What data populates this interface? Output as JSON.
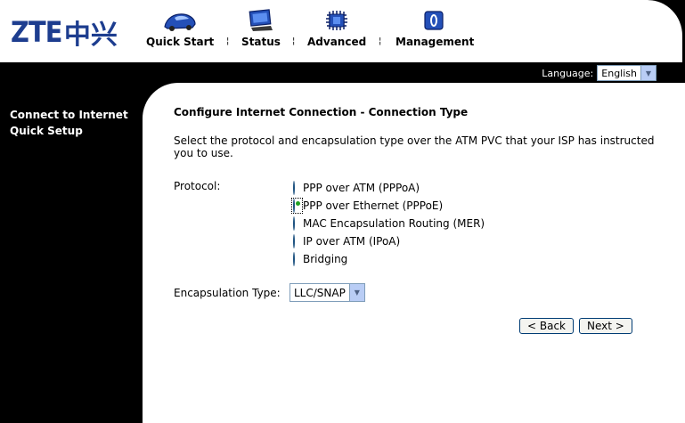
{
  "brand": {
    "name": "ZTE",
    "cn": "中兴"
  },
  "nav": [
    {
      "label": "Quick Start",
      "icon": "car-icon"
    },
    {
      "label": "Status",
      "icon": "monitor-icon"
    },
    {
      "label": "Advanced",
      "icon": "chip-icon"
    },
    {
      "label": "Management",
      "icon": "shield-icon"
    }
  ],
  "nav_separator": "¦",
  "language": {
    "label": "Language:",
    "value": "English"
  },
  "sidebar": {
    "items": [
      "Connect to Internet",
      "Quick Setup"
    ]
  },
  "page": {
    "title": "Configure Internet Connection - Connection Type",
    "description": "Select the protocol and encapsulation type over the ATM PVC that your ISP has instructed you to use.",
    "protocol_label": "Protocol:",
    "protocols": [
      {
        "label": "PPP over ATM (PPPoA)",
        "selected": false
      },
      {
        "label": "PPP over Ethernet (PPPoE)",
        "selected": true
      },
      {
        "label": "MAC Encapsulation Routing (MER)",
        "selected": false
      },
      {
        "label": "IP over ATM (IPoA)",
        "selected": false
      },
      {
        "label": "Bridging",
        "selected": false
      }
    ],
    "encapsulation_label": "Encapsulation Type:",
    "encapsulation_value": "LLC/SNAP",
    "back_label": "< Back",
    "next_label": "Next >"
  },
  "colors": {
    "brand_blue": "#1d3d8f",
    "radio_dot": "#21a121",
    "background": "#000000"
  }
}
